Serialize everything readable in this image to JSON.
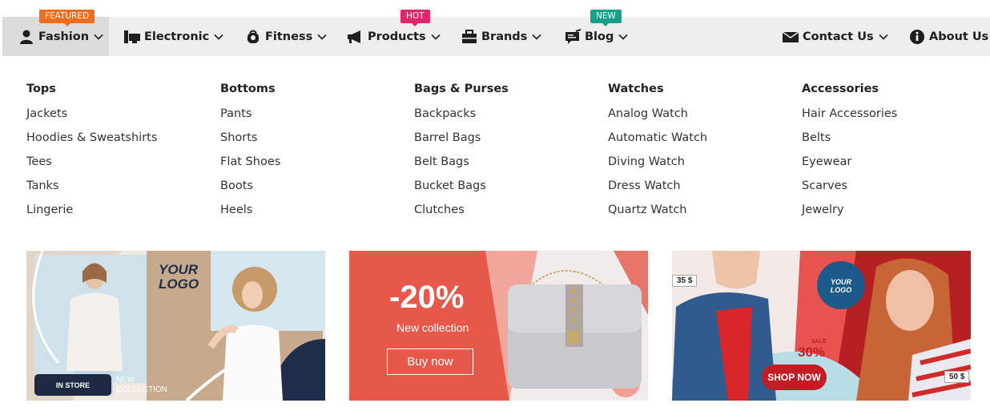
{
  "nav": {
    "items": [
      {
        "label": "Fashion",
        "icon": "user-icon"
      },
      {
        "label": "Electronic",
        "icon": "monitor-icon"
      },
      {
        "label": "Fitness",
        "icon": "fitness-icon"
      },
      {
        "label": "Products",
        "icon": "megaphone-icon"
      },
      {
        "label": "Brands",
        "icon": "briefcase-icon"
      },
      {
        "label": "Blog",
        "icon": "blog-icon"
      },
      {
        "label": "Contact Us",
        "icon": "envelope-icon"
      },
      {
        "label": "About Us",
        "icon": "info-icon"
      }
    ],
    "badges": {
      "featured": "FEATURED",
      "hot": "HOT",
      "new": "NEW"
    }
  },
  "menu": {
    "columns": [
      {
        "title": "Tops",
        "links": [
          "Jackets",
          "Hoodies & Sweatshirts",
          "Tees",
          "Tanks",
          "Lingerie"
        ]
      },
      {
        "title": "Bottoms",
        "links": [
          "Pants",
          "Shorts",
          "Flat Shoes",
          "Boots",
          "Heels"
        ]
      },
      {
        "title": "Bags & Purses",
        "links": [
          "Backpacks",
          "Barrel Bags",
          "Belt Bags",
          "Bucket Bags",
          "Clutches"
        ]
      },
      {
        "title": "Watches",
        "links": [
          "Analog Watch",
          "Automatic Watch",
          "Diving Watch",
          "Dress Watch",
          "Quartz Watch"
        ]
      },
      {
        "title": "Accessories",
        "links": [
          "Hair Accessories",
          "Belts",
          "Eyewear",
          "Scarves",
          "Jewelry"
        ]
      }
    ]
  },
  "banners": {
    "b1": {
      "logo_line1": "YOUR",
      "logo_line2": "LOGO",
      "button": "IN STORE",
      "caption_line1": "NEW",
      "caption_line2": "COLLECTION"
    },
    "b2": {
      "discount": "-20%",
      "subtitle": "New collection",
      "button": "Buy now"
    },
    "b3": {
      "price1": "35 $",
      "price2": "50 $",
      "logo_line1": "YOUR",
      "logo_line2": "LOGO",
      "sale_label": "SALE",
      "sale_value": "30%",
      "button": "SHOP NOW"
    }
  },
  "colors": {
    "featured": "#f26c1d",
    "hot": "#e3266a",
    "new": "#15a18a",
    "nav_bg": "#eeeeee",
    "active_bg": "#dcdcdc"
  }
}
